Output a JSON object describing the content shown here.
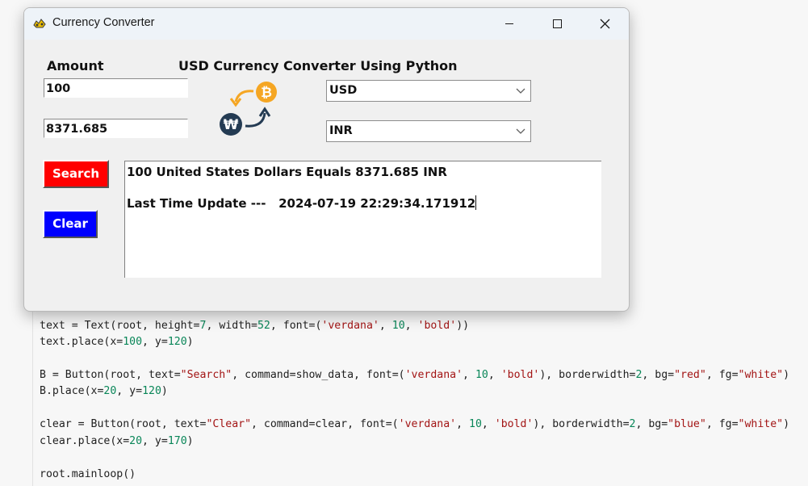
{
  "window": {
    "title": "Currency Converter",
    "heading": "USD Currency Converter Using Python",
    "amount_label": "Amount",
    "amount_value": "100",
    "result_value": "8371.685",
    "from_currency": "USD",
    "to_currency": "INR",
    "search_label": "Search",
    "clear_label": "Clear",
    "output_line1": "100 United States Dollars Equals 8371.685 INR",
    "output_line2": "Last Time Update ---   2024-07-19 22:29:34.171912"
  },
  "colors": {
    "search_button": "#ff0000",
    "clear_button": "#0000ff",
    "coin_orange": "#f5a623",
    "won_navy": "#243b53"
  },
  "icons": [
    "app-icon",
    "minimize-icon",
    "maximize-icon",
    "close-icon",
    "chevron-down-icon",
    "bitcoin-icon",
    "won-icon"
  ]
}
